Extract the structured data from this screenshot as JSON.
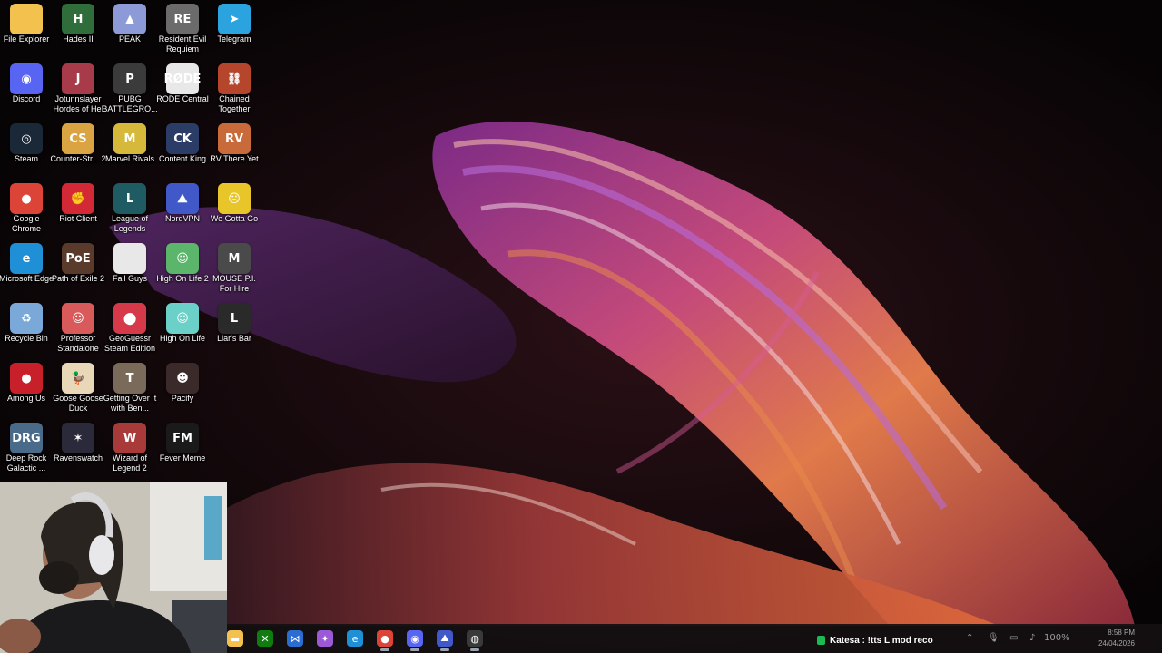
{
  "desktop": {
    "icons": [
      {
        "label": "File Explorer",
        "icon": "folder-icon",
        "color": "#f2c14e",
        "text": ""
      },
      {
        "label": "Hades II",
        "icon": "hades-icon",
        "color": "#2f6d3a",
        "text": "H"
      },
      {
        "label": "PEAK",
        "icon": "peak-icon",
        "color": "#8c9bd8",
        "text": "▲"
      },
      {
        "label": "Resident Evil Requiem",
        "icon": "resident-evil-icon",
        "color": "#6b6b6b",
        "text": "RE"
      },
      {
        "label": "Telegram",
        "icon": "telegram-icon",
        "color": "#2aa3df",
        "text": "➤"
      },
      {
        "label": "Discord",
        "icon": "discord-icon",
        "color": "#5865f2",
        "text": "◉"
      },
      {
        "label": "Jotunnslayer Hordes of Hel",
        "icon": "jotunnslayer-icon",
        "color": "#a83b4a",
        "text": "J"
      },
      {
        "label": "PUBG BATTLEGRO...",
        "icon": "pubg-icon",
        "color": "#3b3b3b",
        "text": "P"
      },
      {
        "label": "RODE Central",
        "icon": "rode-icon",
        "color": "#e8e8e8",
        "text": "RØDE"
      },
      {
        "label": "Chained Together",
        "icon": "chained-together-icon",
        "color": "#b5462c",
        "text": "⛓"
      },
      {
        "label": "Steam",
        "icon": "steam-icon",
        "color": "#1b2838",
        "text": "◎"
      },
      {
        "label": "Counter-Str... 2",
        "icon": "counter-strike-icon",
        "color": "#d9a441",
        "text": "CS"
      },
      {
        "label": "Marvel Rivals",
        "icon": "marvel-rivals-icon",
        "color": "#d6b93a",
        "text": "M"
      },
      {
        "label": "Content King",
        "icon": "content-king-icon",
        "color": "#2b3c66",
        "text": "CK"
      },
      {
        "label": "RV There Yet",
        "icon": "rv-there-yet-icon",
        "color": "#c86a3a",
        "text": "RV"
      },
      {
        "label": "Google Chrome",
        "icon": "chrome-icon",
        "color": "#db4437",
        "text": "●"
      },
      {
        "label": "Riot Client",
        "icon": "riot-client-icon",
        "color": "#d32936",
        "text": "✊"
      },
      {
        "label": "League of Legends",
        "icon": "league-of-legends-icon",
        "color": "#1f5b63",
        "text": "L"
      },
      {
        "label": "NordVPN",
        "icon": "nordvpn-icon",
        "color": "#4058c8",
        "text": "⛰"
      },
      {
        "label": "We Gotta Go",
        "icon": "we-gotta-go-icon",
        "color": "#e8c62a",
        "text": "☹"
      },
      {
        "label": "Microsoft Edge",
        "icon": "edge-icon",
        "color": "#1f8fd6",
        "text": "e"
      },
      {
        "label": "Path of Exile 2",
        "icon": "path-of-exile-icon",
        "color": "#5a3a2a",
        "text": "PoE"
      },
      {
        "label": "Fall Guys",
        "icon": "fall-guys-icon",
        "color": "#e8e8e8",
        "text": ""
      },
      {
        "label": "High On Life 2",
        "icon": "high-on-life-2-icon",
        "color": "#5bb56a",
        "text": "☺"
      },
      {
        "label": "MOUSE P.I. For Hire",
        "icon": "mouse-pi-icon",
        "color": "#4a4a4a",
        "text": "M"
      },
      {
        "label": "Recycle Bin",
        "icon": "recycle-bin-icon",
        "color": "#7aa8d8",
        "text": "♻"
      },
      {
        "label": "Professor Standalone",
        "icon": "professor-icon",
        "color": "#d85a5a",
        "text": "☺"
      },
      {
        "label": "GeoGuessr Steam Edition",
        "icon": "geoguessr-icon",
        "color": "#d63a4a",
        "text": "⬤"
      },
      {
        "label": "High On Life",
        "icon": "high-on-life-icon",
        "color": "#6ad0c8",
        "text": "☺"
      },
      {
        "label": "Liar's Bar",
        "icon": "liars-bar-icon",
        "color": "#2a2a2a",
        "text": "L"
      },
      {
        "label": "Among Us",
        "icon": "among-us-icon",
        "color": "#c8202a",
        "text": "●"
      },
      {
        "label": "Goose Goose Duck",
        "icon": "goose-goose-duck-icon",
        "color": "#e8d8b8",
        "text": "🦆"
      },
      {
        "label": "Getting Over It with Ben...",
        "icon": "getting-over-it-icon",
        "color": "#7a6a5a",
        "text": "T"
      },
      {
        "label": "Pacify",
        "icon": "pacify-icon",
        "color": "#3a2a2a",
        "text": "☻"
      },
      {
        "label": "",
        "icon": "blank-slot",
        "color": "transparent",
        "text": ""
      },
      {
        "label": "Deep Rock Galactic ...",
        "icon": "deep-rock-galactic-icon",
        "color": "#4a6a8a",
        "text": "DRG"
      },
      {
        "label": "Ravenswatch",
        "icon": "ravenswatch-icon",
        "color": "#2a2a3a",
        "text": "✶"
      },
      {
        "label": "Wizard of Legend 2",
        "icon": "wizard-of-legend-icon",
        "color": "#a83a3a",
        "text": "W"
      },
      {
        "label": "Fever Meme",
        "icon": "fever-meme-icon",
        "color": "#1a1a1a",
        "text": "FM"
      }
    ]
  },
  "taskbar": {
    "apps": [
      {
        "icon": "file-explorer-icon",
        "color": "#f2c14e",
        "text": "▬",
        "active": false
      },
      {
        "icon": "xbox-icon",
        "color": "#107c10",
        "text": "✕",
        "active": false
      },
      {
        "icon": "vscode-icon",
        "color": "#2b6cd1",
        "text": "⋈",
        "active": false
      },
      {
        "icon": "copilot-icon",
        "color": "#9b59d6",
        "text": "✦",
        "active": false
      },
      {
        "icon": "edge-icon",
        "color": "#1f8fd6",
        "text": "e",
        "active": false
      },
      {
        "icon": "chrome-icon",
        "color": "#db4437",
        "text": "●",
        "active": true
      },
      {
        "icon": "discord-icon",
        "color": "#5865f2",
        "text": "◉",
        "active": true
      },
      {
        "icon": "nordvpn-icon",
        "color": "#4058c8",
        "text": "⛰",
        "active": true
      },
      {
        "icon": "obs-icon",
        "color": "#3a3a3a",
        "text": "◍",
        "active": true
      }
    ],
    "notification": {
      "icon": "now-playing-icon",
      "text": "Katesa : !tts L mod reco"
    },
    "tray": {
      "battery_text": "100%",
      "chevron_icon": "chevron-up-icon",
      "mic_icon": "microphone-icon",
      "display_icon": "display-icon",
      "volume_icon": "speaker-icon"
    },
    "clock": {
      "time": "8:58 PM",
      "date": "24/04/2026"
    }
  }
}
